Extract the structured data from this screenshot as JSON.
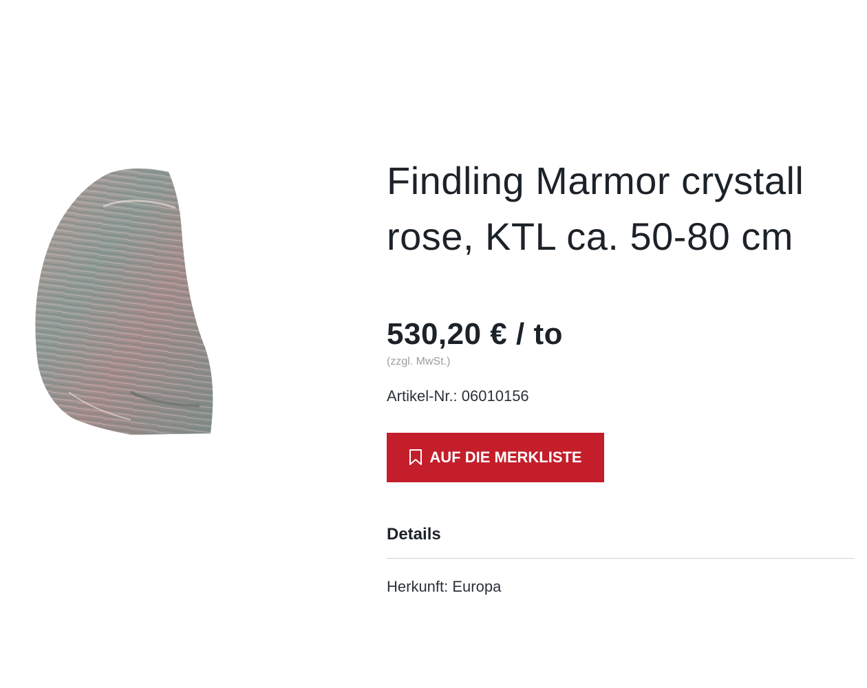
{
  "product": {
    "image_watermark": "Seib GmbH",
    "title_line1": "Findling Marmor crystall",
    "title_line2": "rose, KTL ca. 50-80 cm",
    "price": "530,20 € / to",
    "tax_note": "(zzgl. MwSt.)",
    "sku": "Artikel-Nr.: 06010156",
    "wishlist_label": "AUF DIE MERKLISTE",
    "details_heading": "Details",
    "origin": "Herkunft: Europa"
  },
  "colors": {
    "accent": "#c41e2b",
    "text": "#1c2228",
    "muted": "#9a9ea2",
    "divider": "#cfd2d5"
  },
  "icons": {
    "wishlist": "bookmark-icon"
  }
}
